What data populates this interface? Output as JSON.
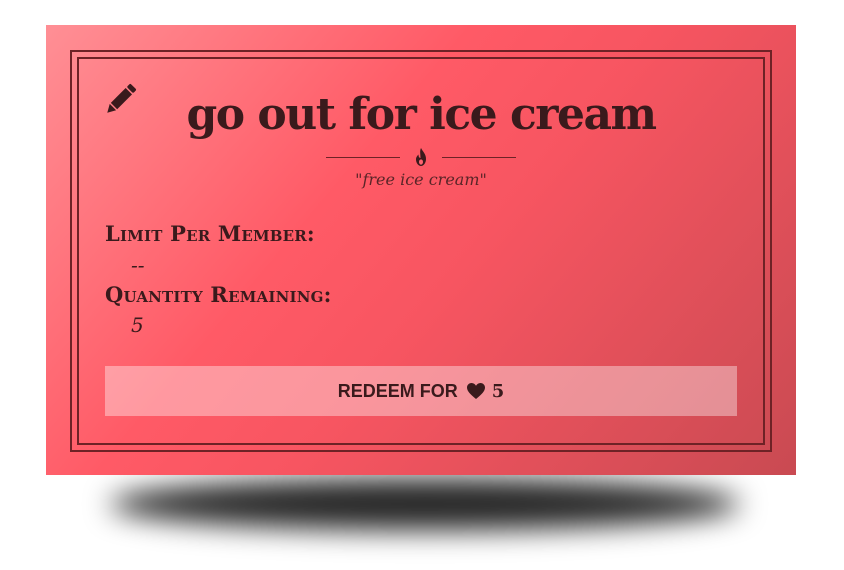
{
  "reward": {
    "title": "go out for ice cream",
    "notes": "\"free ice cream\"",
    "limit_label": "Limit Per Member:",
    "limit_value": "--",
    "quantity_label": "Quantity Remaining:",
    "quantity_value": "5"
  },
  "redeem": {
    "label": "REDEEM FOR",
    "cost": "5",
    "icon": "heart-icon"
  },
  "icons": {
    "edit": "pencil-icon",
    "divider": "flame-icon"
  },
  "colors": {
    "card_start": "#ff8f95",
    "card_mid": "#ff5a66",
    "card_end": "#c94a52",
    "text": "#3a1a1c",
    "border": "#6e2226"
  }
}
